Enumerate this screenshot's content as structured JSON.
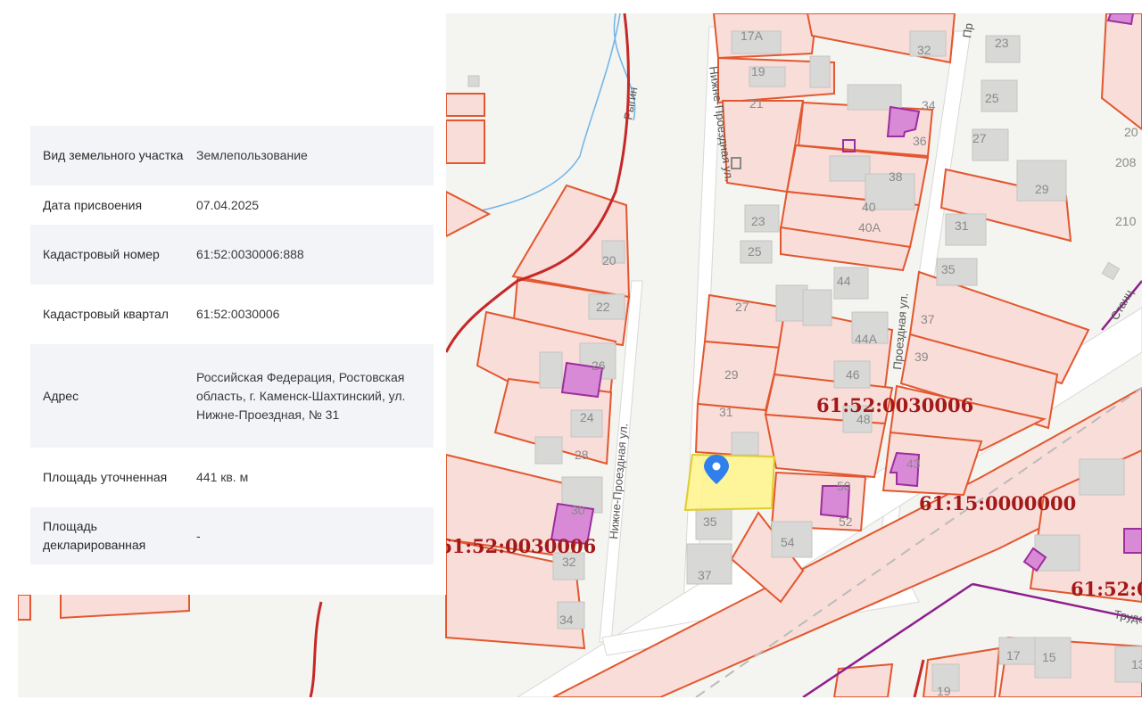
{
  "parcel_info": {
    "rows": [
      {
        "label": "Вид земельного участка",
        "value": "Землепользование"
      },
      {
        "label": "Дата присвоения",
        "value": "07.04.2025"
      },
      {
        "label": "Кадастровый номер",
        "value": "61:52:0030006:888"
      },
      {
        "label": "Кадастровый квартал",
        "value": "61:52:0030006"
      },
      {
        "label": "Адрес",
        "value": "Российская Федерация, Ростовская область, г. Каменск-Шахтинский, ул. Нижне-Проездная, № 31"
      },
      {
        "label": "Площадь уточненная",
        "value": "441 кв. м"
      },
      {
        "label": "Площадь декларированная",
        "value": "-"
      }
    ]
  },
  "map": {
    "quarter_labels": [
      "61:52:0030006",
      "61:52:0030006",
      "61:15:0000000",
      "61:52:0"
    ],
    "streets": [
      "Нижне-Проездная ул.",
      "Нижне-Проездная ул.",
      "Нижне-Проездная ул.",
      "Проездная ул.",
      "Станц",
      "Трудо",
      "Пр"
    ],
    "river": "Рыгин",
    "house_numbers": [
      "17А",
      "19",
      "21",
      "23",
      "25",
      "27",
      "29",
      "31",
      "35",
      "37",
      "20",
      "22",
      "26",
      "24",
      "28",
      "30",
      "32",
      "34",
      "36",
      "38",
      "40",
      "40А",
      "44",
      "44А",
      "46",
      "48",
      "50",
      "52",
      "54",
      "23",
      "25",
      "27",
      "29",
      "31",
      "35",
      "37",
      "39",
      "43",
      "15",
      "17",
      "19",
      "20",
      "208",
      "210",
      "13"
    ],
    "colors": {
      "parcel_fill": "#f9ddd8",
      "parcel_stroke": "#e2572f",
      "quarter_border": "#c62828",
      "building_fill": "#d98ad6",
      "building_stroke": "#9c2e9e",
      "selected_fill": "#fff38a",
      "selected_stroke": "#e0cc30",
      "marker": "#2f80ed",
      "label_red": "#a31919",
      "river": "#6fb4e8"
    },
    "marker_icon": "map-pin-icon"
  }
}
